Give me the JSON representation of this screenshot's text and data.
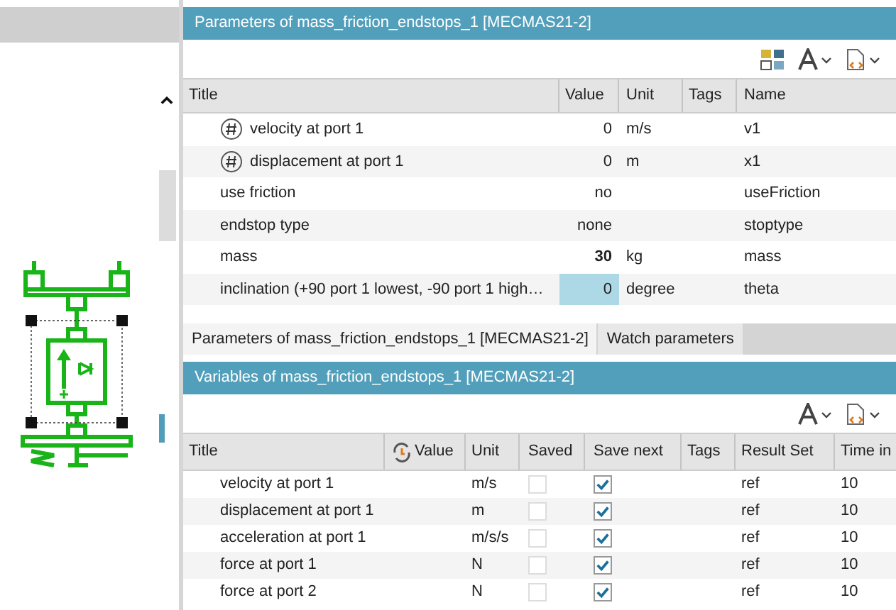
{
  "parameters_panel": {
    "title": "Parameters of mass_friction_endstops_1 [MECMAS21-2]",
    "columns": [
      "Title",
      "Value",
      "Unit",
      "Tags",
      "Name"
    ],
    "rows": [
      {
        "kind": "variable",
        "title": "velocity at port 1",
        "value": "0",
        "unit": "m/s",
        "name": "v1",
        "bold": false,
        "selected": false
      },
      {
        "kind": "variable",
        "title": "displacement at port 1",
        "value": "0",
        "unit": "m",
        "name": "x1",
        "bold": false,
        "selected": false
      },
      {
        "kind": "plain",
        "title": "use friction",
        "value": "no",
        "name": "useFriction",
        "bold": false,
        "selected": false
      },
      {
        "kind": "plain",
        "title": "endstop type",
        "value": "none",
        "name": "stoptype",
        "bold": false,
        "selected": false
      },
      {
        "kind": "plain",
        "title": "mass",
        "value": "30",
        "unit": "kg",
        "name": "mass",
        "bold": true,
        "selected": false
      },
      {
        "kind": "plain",
        "title": "inclination (+90 port 1 lowest, -90 port 1 high…",
        "value": "0",
        "unit": "degree",
        "name": "theta",
        "bold": false,
        "selected": true
      }
    ]
  },
  "tabs": [
    {
      "label": "Parameters of mass_friction_endstops_1 [MECMAS21-2]",
      "selected": true
    },
    {
      "label": "Watch parameters",
      "selected": false
    }
  ],
  "variables_panel": {
    "title": "Variables of mass_friction_endstops_1 [MECMAS21-2]",
    "columns": [
      "Title",
      "Value",
      "Unit",
      "Saved",
      "Save next",
      "Tags",
      "Result Set",
      "Time in"
    ],
    "rows": [
      {
        "title": "velocity at port 1",
        "unit": "m/s",
        "saved": false,
        "save_next": true,
        "result_set": "ref",
        "time": "10"
      },
      {
        "title": "displacement at port 1",
        "unit": "m",
        "saved": false,
        "save_next": true,
        "result_set": "ref",
        "time": "10"
      },
      {
        "title": "acceleration at port 1",
        "unit": "m/s/s",
        "saved": false,
        "save_next": true,
        "result_set": "ref",
        "time": "10"
      },
      {
        "title": "force at port 1",
        "unit": "N",
        "saved": false,
        "save_next": true,
        "result_set": "ref",
        "time": "10"
      },
      {
        "title": "force at port 2",
        "unit": "N",
        "saved": false,
        "save_next": true,
        "result_set": "ref",
        "time": "10"
      }
    ]
  }
}
